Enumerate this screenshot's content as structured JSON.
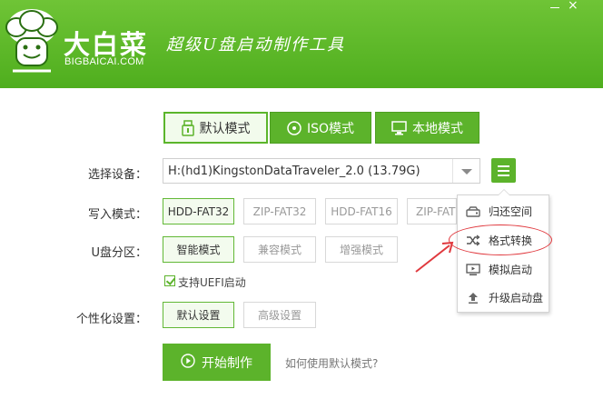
{
  "header": {
    "brand_cn": "大白菜",
    "brand_en": "BIGBAICAI.COM",
    "slogan": "超级U盘启动制作工具",
    "minimize_icon": "minimize-icon",
    "close_icon": "close-icon",
    "close_glyph": "×"
  },
  "tabs": [
    {
      "label": "默认模式",
      "icon": "usb-drive-icon",
      "active": true
    },
    {
      "label": "ISO模式",
      "icon": "disc-icon",
      "active": false
    },
    {
      "label": "本地模式",
      "icon": "monitor-icon",
      "active": false
    }
  ],
  "device": {
    "label": "选择设备：",
    "value": "H:(hd1)KingstonDataTraveler_2.0 (13.79G)"
  },
  "write_mode": {
    "label": "写入模式：",
    "options": [
      "HDD-FAT32",
      "ZIP-FAT32",
      "HDD-FAT16",
      "ZIP-FAT"
    ],
    "selected": "HDD-FAT32"
  },
  "partition": {
    "label": "U盘分区：",
    "options": [
      "智能模式",
      "兼容模式",
      "增强模式"
    ],
    "selected": "智能模式"
  },
  "uefi": {
    "label": "支持UEFI启动",
    "checked": true
  },
  "personalize": {
    "label": "个性化设置：",
    "options": [
      "默认设置",
      "高级设置"
    ],
    "selected": "默认设置"
  },
  "start": {
    "label": "开始制作",
    "icon": "play-circle-icon"
  },
  "help_link": "如何使用默认模式?",
  "menu": {
    "icon": "hamburger-menu-icon",
    "items": [
      {
        "label": "归还空间",
        "icon": "hard-drive-icon"
      },
      {
        "label": "格式转换",
        "icon": "shuffle-icon"
      },
      {
        "label": "模拟启动",
        "icon": "monitor-play-icon"
      },
      {
        "label": "升级启动盘",
        "icon": "upload-arrow-icon"
      }
    ]
  },
  "colors": {
    "accent": "#5cb32b",
    "header": "#58b426",
    "annotation": "#e0393e"
  }
}
